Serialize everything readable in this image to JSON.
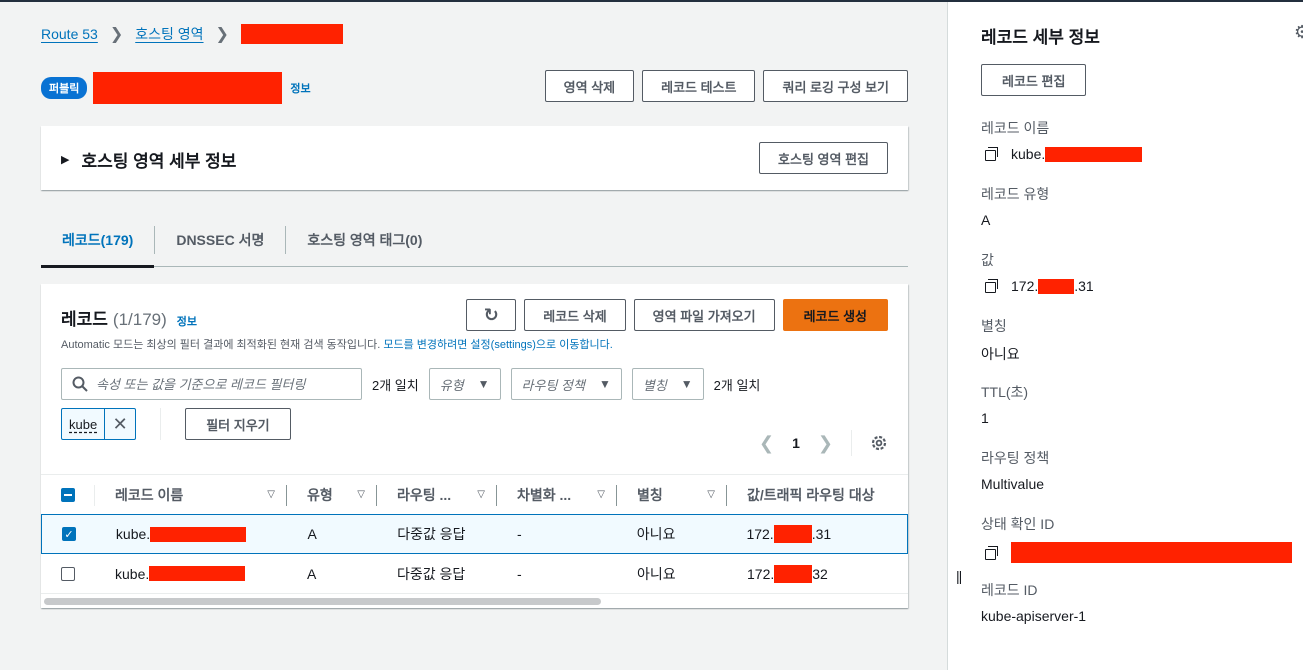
{
  "breadcrumb": {
    "items": [
      "Route 53",
      "호스팅 영역"
    ],
    "separator": "›"
  },
  "zone": {
    "badge": "퍼블릭",
    "info": "정보"
  },
  "top_actions": {
    "delete_zone": "영역 삭제",
    "test_record": "레코드 테스트",
    "query_logging": "쿼리 로깅 구성 보기"
  },
  "details": {
    "title": "호스팅 영역 세부 정보",
    "edit_button": "호스팅 영역 편집"
  },
  "tabs": [
    {
      "label": "레코드(179)",
      "active": true
    },
    {
      "label": "DNSSEC 서명",
      "active": false
    },
    {
      "label": "호스팅 영역 태그(0)",
      "active": false
    }
  ],
  "records": {
    "title": "레코드",
    "count": "(1/179)",
    "info": "정보",
    "description": "Automatic 모드는 최상의 필터 결과에 최적화된 현재 검색 동작입니다.",
    "description_link": "모드를 변경하려면 설정(settings)으로 이동합니다.",
    "actions": {
      "refresh_icon": "refresh-icon",
      "delete": "레코드 삭제",
      "import": "영역 파일 가져오기",
      "create": "레코드 생성"
    },
    "filter": {
      "placeholder": "속성 또는 값을 기준으로 레코드 필터링",
      "match_text_1": "2개 일치",
      "type_select": "유형",
      "routing_select": "라우팅 정책",
      "alias_select": "별칭",
      "match_text_2": "2개 일치",
      "token": "kube",
      "clear": "필터 지우기"
    },
    "pagination": {
      "page": "1"
    },
    "columns": [
      "레코드 이름",
      "유형",
      "라우팅 ...",
      "차별화 ...",
      "별칭",
      "값/트래픽 라우팅 대상"
    ],
    "rows": [
      {
        "selected": true,
        "name_prefix": "kube.",
        "type": "A",
        "routing": "다중값 응답",
        "differentiator": "-",
        "alias": "아니요",
        "value_prefix": "172.",
        "value_suffix": ".31"
      },
      {
        "selected": false,
        "name_prefix": "kube.",
        "type": "A",
        "routing": "다중값 응답",
        "differentiator": "-",
        "alias": "아니요",
        "value_prefix": "172.",
        "value_suffix": "32"
      }
    ]
  },
  "side_panel": {
    "title": "레코드 세부 정보",
    "edit_button": "레코드 편집",
    "fields": {
      "name_label": "레코드 이름",
      "name_prefix": "kube.",
      "type_label": "레코드 유형",
      "type_value": "A",
      "value_label": "값",
      "value_prefix": "172.",
      "value_suffix": ".31",
      "alias_label": "별칭",
      "alias_value": "아니요",
      "ttl_label": "TTL(초)",
      "ttl_value": "1",
      "routing_label": "라우팅 정책",
      "routing_value": "Multivalue",
      "health_label": "상태 확인 ID",
      "record_id_label": "레코드 ID",
      "record_id_value": "kube-apiserver-1"
    }
  },
  "colors": {
    "link": "#0073bb",
    "primary": "#ec7211",
    "redaction": "#ff2200"
  }
}
